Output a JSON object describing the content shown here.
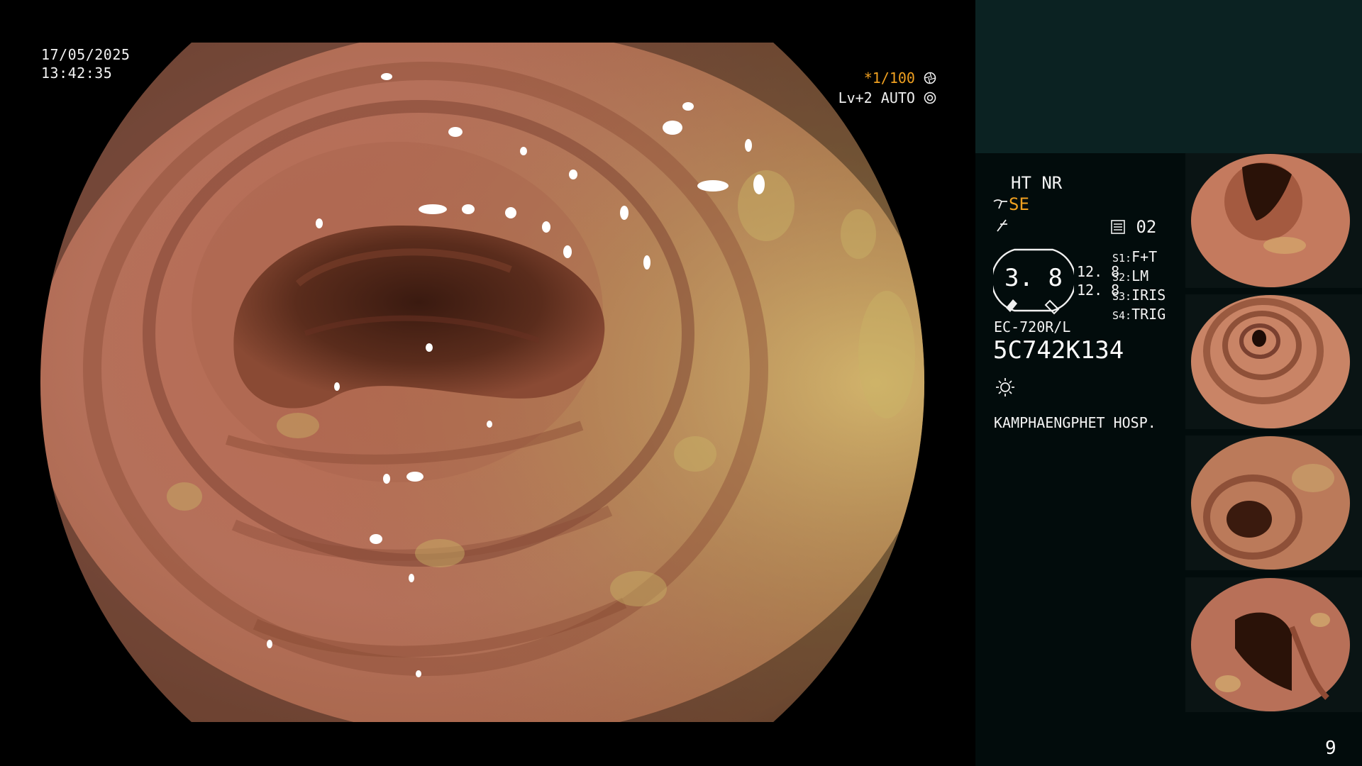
{
  "datetime": {
    "date": "17/05/2025",
    "time": "13:42:35"
  },
  "shutter": {
    "prefix": "*",
    "value": "1/100",
    "level": "Lv+2",
    "mode": "AUTO"
  },
  "settings": {
    "ht": "HT NR",
    "se": "SE",
    "mem_num": "02"
  },
  "gauge": {
    "center": "3. 8",
    "left_val_1": "12. 8",
    "left_val_2": "12. 8"
  },
  "scope_switches": [
    {
      "key": "S1:",
      "value": "F+T"
    },
    {
      "key": "S2:",
      "value": "LM"
    },
    {
      "key": "S3:",
      "value": "IRIS"
    },
    {
      "key": "S4:",
      "value": "TRIG"
    }
  ],
  "scope": {
    "model": "EC-720R/L",
    "serial": "5C742K134"
  },
  "hospital": "KAMPHAENGPHET HOSP.",
  "page_number": "9",
  "colors": {
    "accent": "#f0a020",
    "panel_top": "#0b2222",
    "panel": "#020c0c"
  },
  "icons": [
    "aperture-icon",
    "light-source-icon",
    "memo-icon",
    "brightness-icon"
  ]
}
